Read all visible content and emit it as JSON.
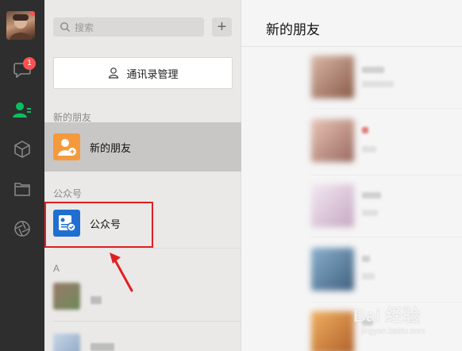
{
  "rail": {
    "chat_badge": "1",
    "icons": [
      "chat-icon",
      "contacts-icon",
      "cube-icon",
      "folder-icon",
      "moments-icon"
    ]
  },
  "panel": {
    "search_placeholder": "搜索",
    "add_symbol": "+",
    "manage_label": "通讯录管理",
    "section_new_friends": "新的朋友",
    "new_friends_label": "新的朋友",
    "section_official": "公众号",
    "official_label": "公众号",
    "section_a": "A"
  },
  "content": {
    "title": "新的朋友"
  },
  "watermark": {
    "main": "Bai 经验",
    "sub": "jingyan.baidu.com"
  },
  "colors": {
    "accent_green": "#07c160",
    "badge_red": "#fa5151",
    "new_friend_orange": "#f59a3c",
    "official_blue": "#1f6fd1",
    "highlight_red": "#e02020"
  }
}
